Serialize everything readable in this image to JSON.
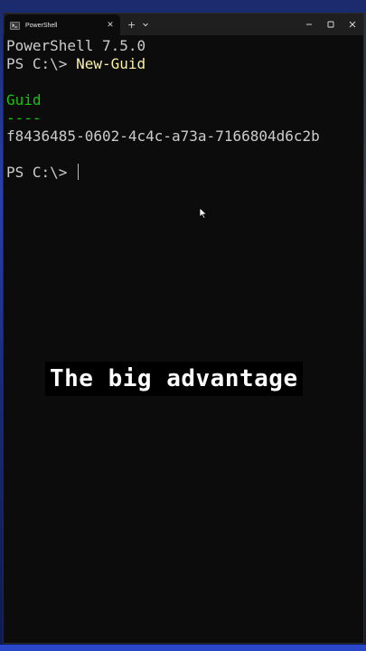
{
  "window": {
    "tab_label": "PowerShell",
    "tab_icon": "terminal-icon",
    "close_tab_glyph": "✕",
    "new_tab_glyph": "+",
    "controls": [
      "minimize-icon",
      "maximize-icon",
      "close-icon"
    ]
  },
  "console": {
    "lines": {
      "version": "PowerShell 7.5.0",
      "prompt1": "PS C:\\> ",
      "command1": "New-Guid",
      "blank1": "",
      "header": "Guid",
      "underline": "----",
      "guid": "f8436485-0602-4c4c-a73a-7166804d6c2b",
      "blank2": "",
      "prompt2": "PS C:\\> "
    }
  },
  "caption": {
    "text": "The big advantage"
  },
  "colors": {
    "background": "#0c0c0c",
    "text": "#cccccc",
    "command": "#f9f1a5",
    "table_header": "#16c60c"
  }
}
